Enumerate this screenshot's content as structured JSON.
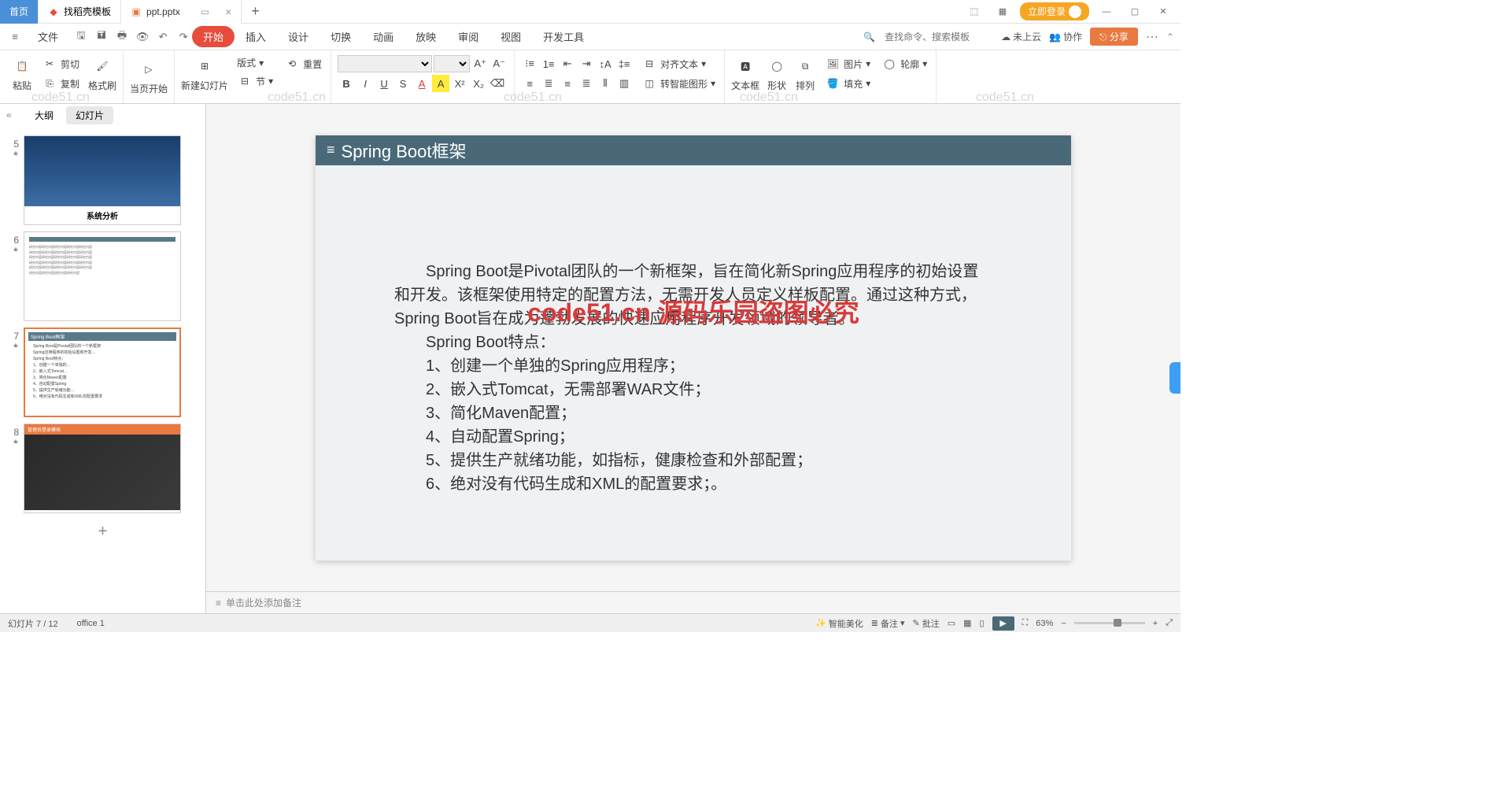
{
  "titlebar": {
    "home": "首页",
    "tab1": "找稻壳模板",
    "tab2": "ppt.pptx",
    "login": "立即登录"
  },
  "menubar": {
    "file": "文件",
    "start": "开始",
    "insert": "插入",
    "design": "设计",
    "transition": "切换",
    "animation": "动画",
    "slideshow": "放映",
    "review": "审阅",
    "view": "视图",
    "devtools": "开发工具",
    "search_ph": "查找命令、搜索模板",
    "cloud": "未上云",
    "collab": "协作",
    "share": "分享"
  },
  "toolbar": {
    "cut": "剪切",
    "copy": "复制",
    "paste": "粘贴",
    "fmtpaint": "格式刷",
    "pagestart": "当页开始",
    "newslide": "新建幻灯片",
    "layout": "版式",
    "section": "节",
    "reset": "重置",
    "aligntext": "对齐文本",
    "smart": "转智能图形",
    "textbox": "文本框",
    "shape": "形状",
    "arrange": "排列",
    "picture": "图片",
    "fill": "填充",
    "outline": "轮廓"
  },
  "sidepanel": {
    "outline": "大纲",
    "slides": "幻灯片",
    "t5_label": "系统分析",
    "t7_hdr": "Spring Boot框架",
    "t8_hdr": "管理员登录模块",
    "n5": "5",
    "n6": "6",
    "n7": "7",
    "n8": "8"
  },
  "slide": {
    "title": "Spring Boot框架",
    "p1": "　　Spring Boot是Pivotal团队的一个新框架，旨在简化新Spring应用程序的初始设置和开发。该框架使用特定的配置方法，无需开发人员定义样板配置。通过这种方式，Spring Boot旨在成为蓬勃发展的快速应用程序开发领域的领导者。",
    "p2": "　　Spring Boot特点：",
    "p3": "　　1、创建一个单独的Spring应用程序；",
    "p4": "　　2、嵌入式Tomcat，无需部署WAR文件；",
    "p5": "　　3、简化Maven配置；",
    "p6": "　　4、自动配置Spring；",
    "p7": "　　5、提供生产就绪功能，如指标，健康检查和外部配置；",
    "p8": "　　6、绝对没有代码生成和XML的配置要求；。",
    "watermark_center": "code51.cn 源码乐园盗图必究"
  },
  "notes": {
    "placeholder": "单击此处添加备注"
  },
  "statusbar": {
    "pos": "幻灯片 7 / 12",
    "mode": "office 1",
    "beautify": "智能美化",
    "notes": "备注",
    "comments": "批注",
    "zoom": "63%"
  },
  "wm": "code51.cn"
}
